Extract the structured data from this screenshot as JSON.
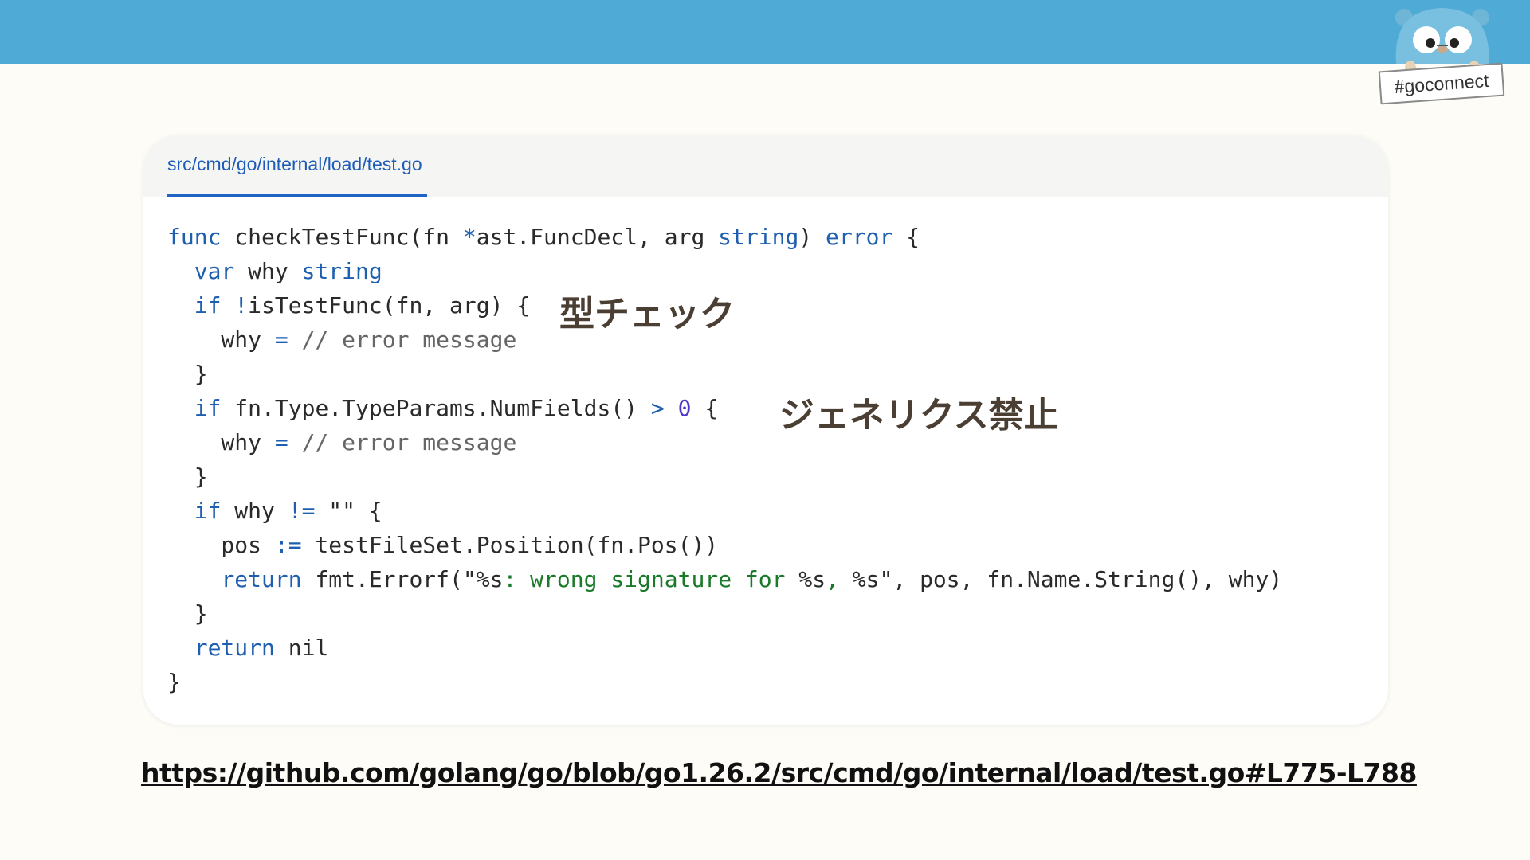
{
  "slide": {
    "hashtag": "#goconnect",
    "file_path": "src/cmd/go/internal/load/test.go",
    "annotations": {
      "type_check": "型チェック",
      "generics_banned": "ジェネリクス禁止"
    },
    "source_url": "https://github.com/golang/go/blob/go1.26.2/src/cmd/go/internal/load/test.go#L775-L788"
  },
  "code": {
    "language": "go",
    "lines": [
      "func checkTestFunc(fn *ast.FuncDecl, arg string) error {",
      "  var why string",
      "  if !isTestFunc(fn, arg) {",
      "    why = // error message",
      "  }",
      "  if fn.Type.TypeParams.NumFields() > 0 {",
      "    why = // error message",
      "  }",
      "  if why != \"\" {",
      "    pos := testFileSet.Position(fn.Pos())",
      "    return fmt.Errorf(\"%s: wrong signature for %s, %s\", pos, fn.Name.String(), why)",
      "  }",
      "  return nil",
      "}"
    ]
  },
  "colors": {
    "header_bar": "#4faad6",
    "background": "#fdfcf6",
    "keyword": "#1f5fb0",
    "tab_accent": "#1f64c4",
    "annotation": "#4a3f32"
  }
}
